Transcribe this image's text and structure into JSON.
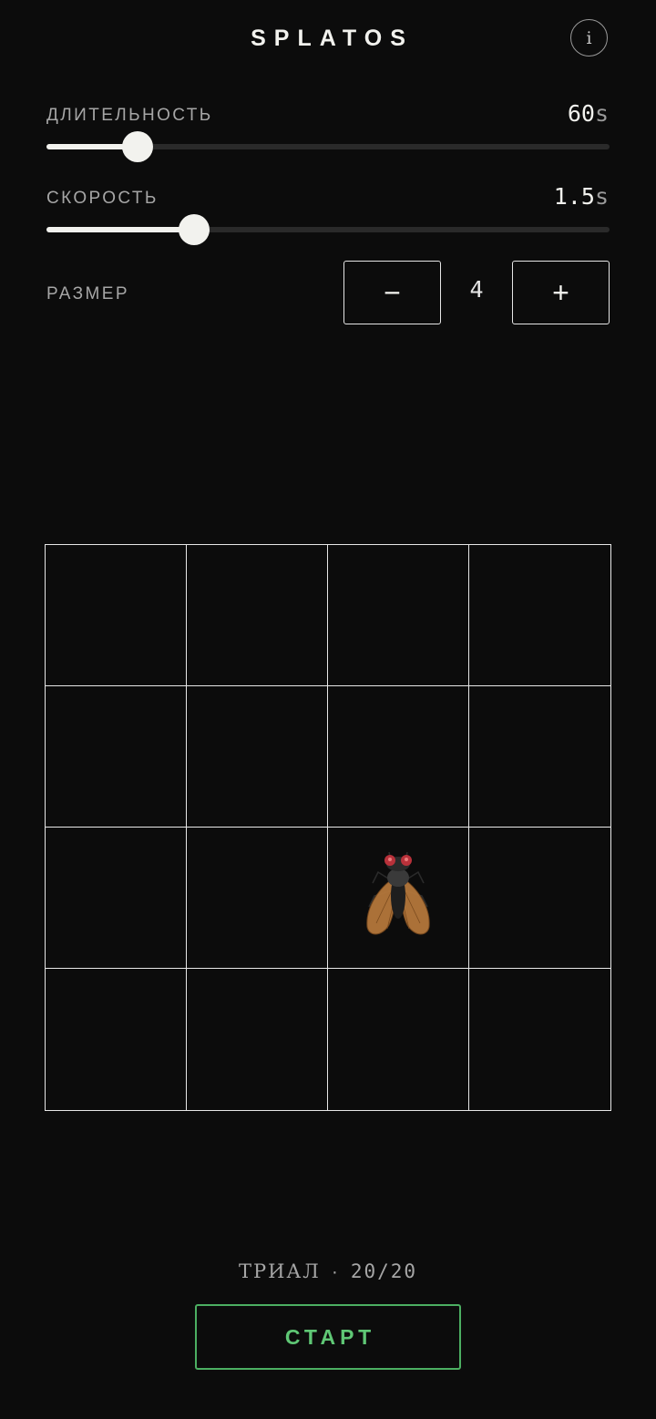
{
  "header": {
    "title": "SPLATOS",
    "info_icon": "i"
  },
  "settings": {
    "duration": {
      "label": "ДЛИТЕЛЬНОСТЬ",
      "value": "60",
      "unit": "s",
      "fraction": 0.162
    },
    "speed": {
      "label": "СКОРОСТЬ",
      "value": "1.5",
      "unit": "s",
      "fraction": 0.262
    },
    "size": {
      "label": "РАЗМЕР",
      "value": "4",
      "minus": "−",
      "plus": "+"
    }
  },
  "board": {
    "rows": 4,
    "cols": 4,
    "target": {
      "row": 2,
      "col": 2,
      "icon": "fly-icon"
    }
  },
  "footer": {
    "trial_label": "ТРИАЛ",
    "separator": "·",
    "trial_count": "20/20",
    "start_label": "СТАРТ"
  },
  "colors": {
    "background": "#0c0c0c",
    "accent": "#4caf62",
    "foreground": "#f2f2ee"
  }
}
